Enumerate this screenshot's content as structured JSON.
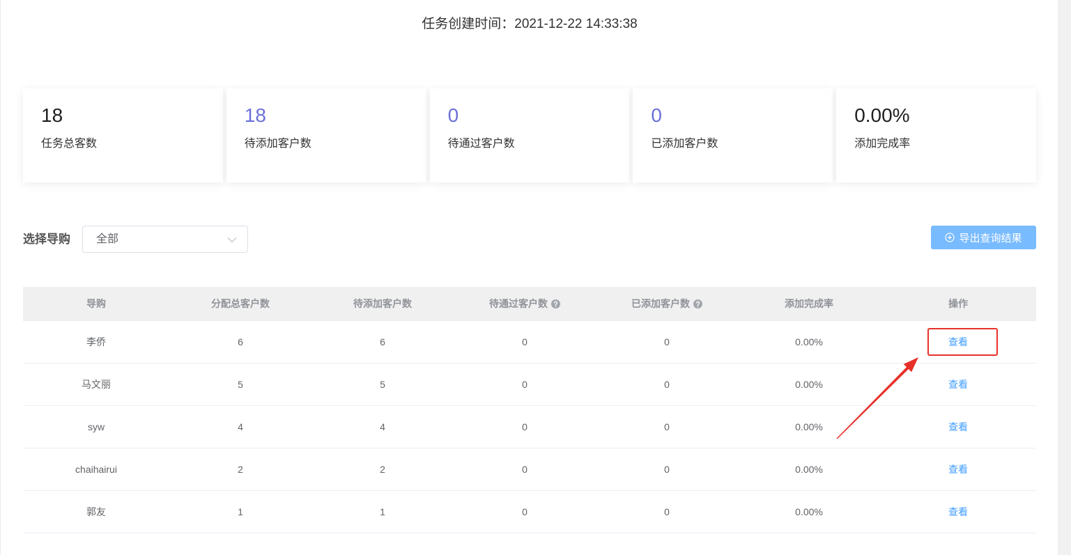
{
  "task": {
    "created_label": "任务创建时间：",
    "created_value": "2021-12-22 14:33:38"
  },
  "stats": [
    {
      "value": 18,
      "label": "任务总客数",
      "color": "#1f1f1f"
    },
    {
      "value": 18,
      "label": "待添加客户数",
      "color": "#6b70d8"
    },
    {
      "value": 0,
      "label": "待通过客户数",
      "color": "#6b70d8"
    },
    {
      "value": 0,
      "label": "已添加客户数",
      "color": "#6b70d8"
    },
    {
      "value": "0.00%",
      "label": "添加完成率",
      "color": "#1f1f1f"
    }
  ],
  "filter": {
    "label": "选择导购",
    "select_value": "全部",
    "select_icon": "chevron-down-icon"
  },
  "export_button": {
    "label": "导出查询结果",
    "icon": "plus-circle-icon",
    "background": "#79bbff"
  },
  "table": {
    "columns": [
      {
        "label": "导购"
      },
      {
        "label": "分配总客户数"
      },
      {
        "label": "待添加客户数"
      },
      {
        "label": "待通过客户数",
        "help_icon": "question-circle-icon"
      },
      {
        "label": "已添加客户数",
        "help_icon": "question-circle-icon"
      },
      {
        "label": "添加完成率"
      },
      {
        "label": "操作"
      }
    ],
    "rows": [
      {
        "guide": "李侨",
        "total": 6,
        "pending_add": 6,
        "pending_pass": 0,
        "added": 0,
        "rate": "0.00%",
        "action": "查看"
      },
      {
        "guide": "马文丽",
        "total": 5,
        "pending_add": 5,
        "pending_pass": 0,
        "added": 0,
        "rate": "0.00%",
        "action": "查看"
      },
      {
        "guide": "syw",
        "total": 4,
        "pending_add": 4,
        "pending_pass": 0,
        "added": 0,
        "rate": "0.00%",
        "action": "查看"
      },
      {
        "guide": "chaihairui",
        "total": 2,
        "pending_add": 2,
        "pending_pass": 0,
        "added": 0,
        "rate": "0.00%",
        "action": "查看"
      },
      {
        "guide": "郭友",
        "total": 1,
        "pending_add": 1,
        "pending_pass": 0,
        "added": 0,
        "rate": "0.00%",
        "action": "查看"
      }
    ]
  },
  "theme": {
    "link": "#409eff",
    "header_text": "#909399",
    "cell_text": "#606266",
    "annotation": "#e8302a"
  }
}
